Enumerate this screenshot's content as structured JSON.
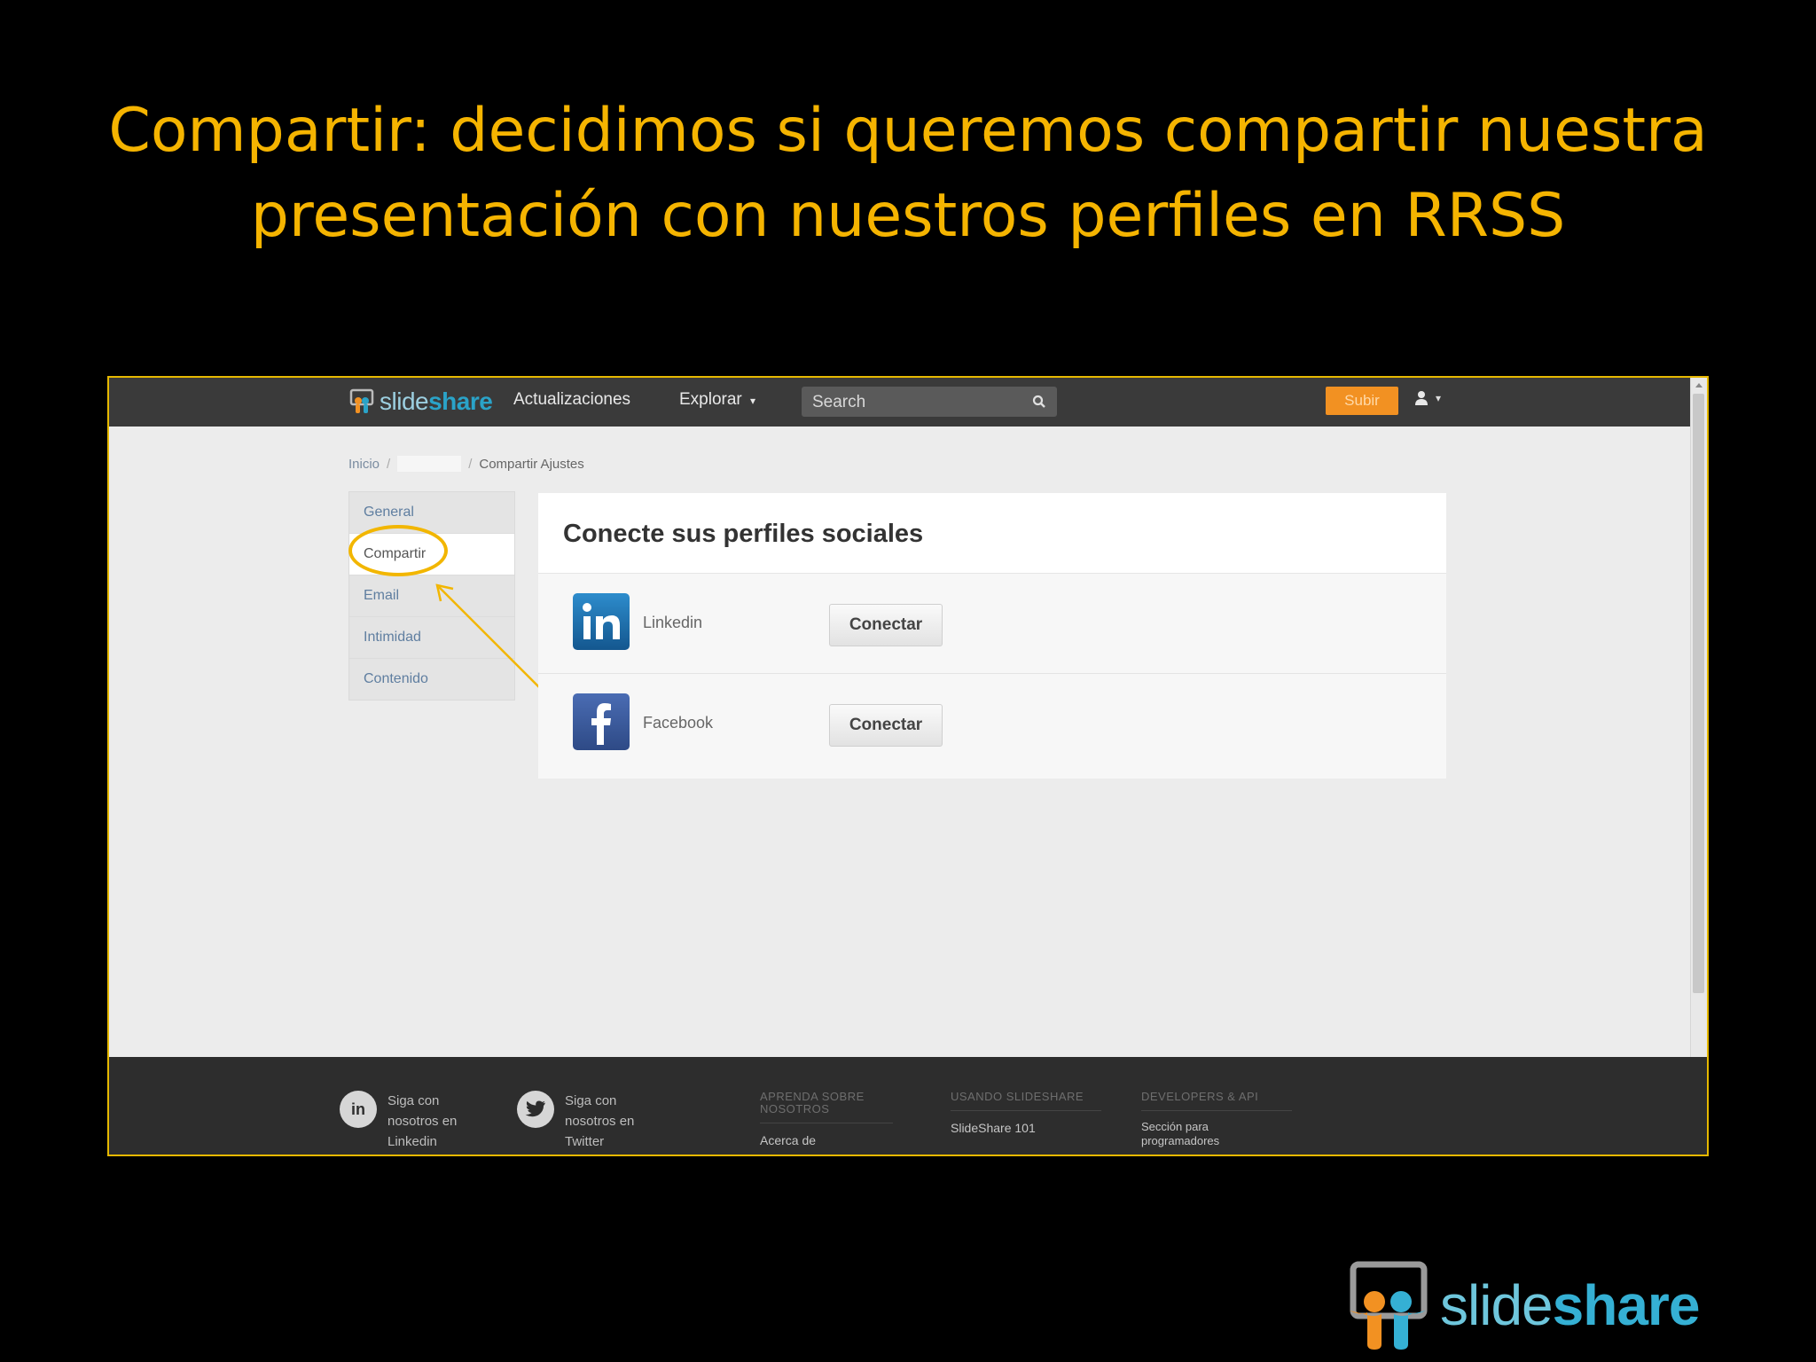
{
  "slide": {
    "title_line1": "Compartir: decidimos si queremos compartir nuestra",
    "title_line2": "presentación con nuestros perfiles en RRSS"
  },
  "navbar": {
    "logo_light": "slide",
    "logo_bold": "share",
    "link_updates": "Actualizaciones",
    "link_explore": "Explorar",
    "search_placeholder": "Search",
    "upload_label": "Subir"
  },
  "breadcrumb": {
    "home": "Inicio",
    "current": "Compartir Ajustes"
  },
  "sidebar": {
    "items": [
      {
        "label": "General"
      },
      {
        "label": "Compartir"
      },
      {
        "label": "Email"
      },
      {
        "label": "Intimidad"
      },
      {
        "label": "Contenido"
      }
    ],
    "active_index": 1
  },
  "panel": {
    "title": "Conecte sus perfiles sociales",
    "rows": [
      {
        "name": "Linkedin",
        "icon": "linkedin-icon",
        "button": "Conectar"
      },
      {
        "name": "Facebook",
        "icon": "facebook-icon",
        "button": "Conectar"
      }
    ]
  },
  "footer": {
    "follow_linkedin": "Siga con nosotros en Linkedin",
    "follow_twitter": "Siga con nosotros en Twitter",
    "col1_head": "APRENDA SOBRE NOSOTROS",
    "col1_link": "Acerca de",
    "col2_head": "USANDO SLIDESHARE",
    "col2_link": "SlideShare 101",
    "col3_head": "DEVELOPERS & API",
    "col3_link": "Sección para programadores"
  },
  "brand": {
    "light": "slide",
    "bold": "share"
  },
  "colors": {
    "title": "#f5b400",
    "highlight": "#f2b600",
    "upload": "#f29122",
    "linkedin": "#1b6aa5",
    "facebook": "#3b5998"
  }
}
